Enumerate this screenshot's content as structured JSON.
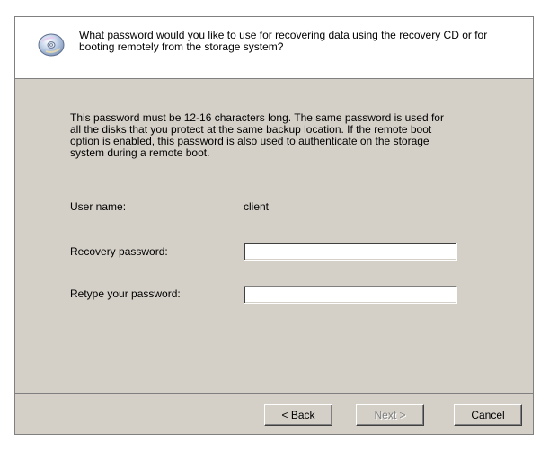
{
  "header": {
    "icon": "cd-disc-icon",
    "question": "What password would you like to use for recovering data using the recovery CD or for booting remotely from the storage system?"
  },
  "description": "This password must be 12-16 characters long. The same password is used for all the disks that you protect at the same backup location. If the remote boot option is enabled, this password is also used to authenticate on the storage system during a remote boot.",
  "form": {
    "username_label": "User name:",
    "username_value": "client",
    "recovery_password_label": "Recovery password:",
    "recovery_password_value": "",
    "retype_password_label": "Retype your password:",
    "retype_password_value": ""
  },
  "buttons": {
    "back": "< Back",
    "next": "Next >",
    "cancel": "Cancel",
    "next_enabled": false
  }
}
